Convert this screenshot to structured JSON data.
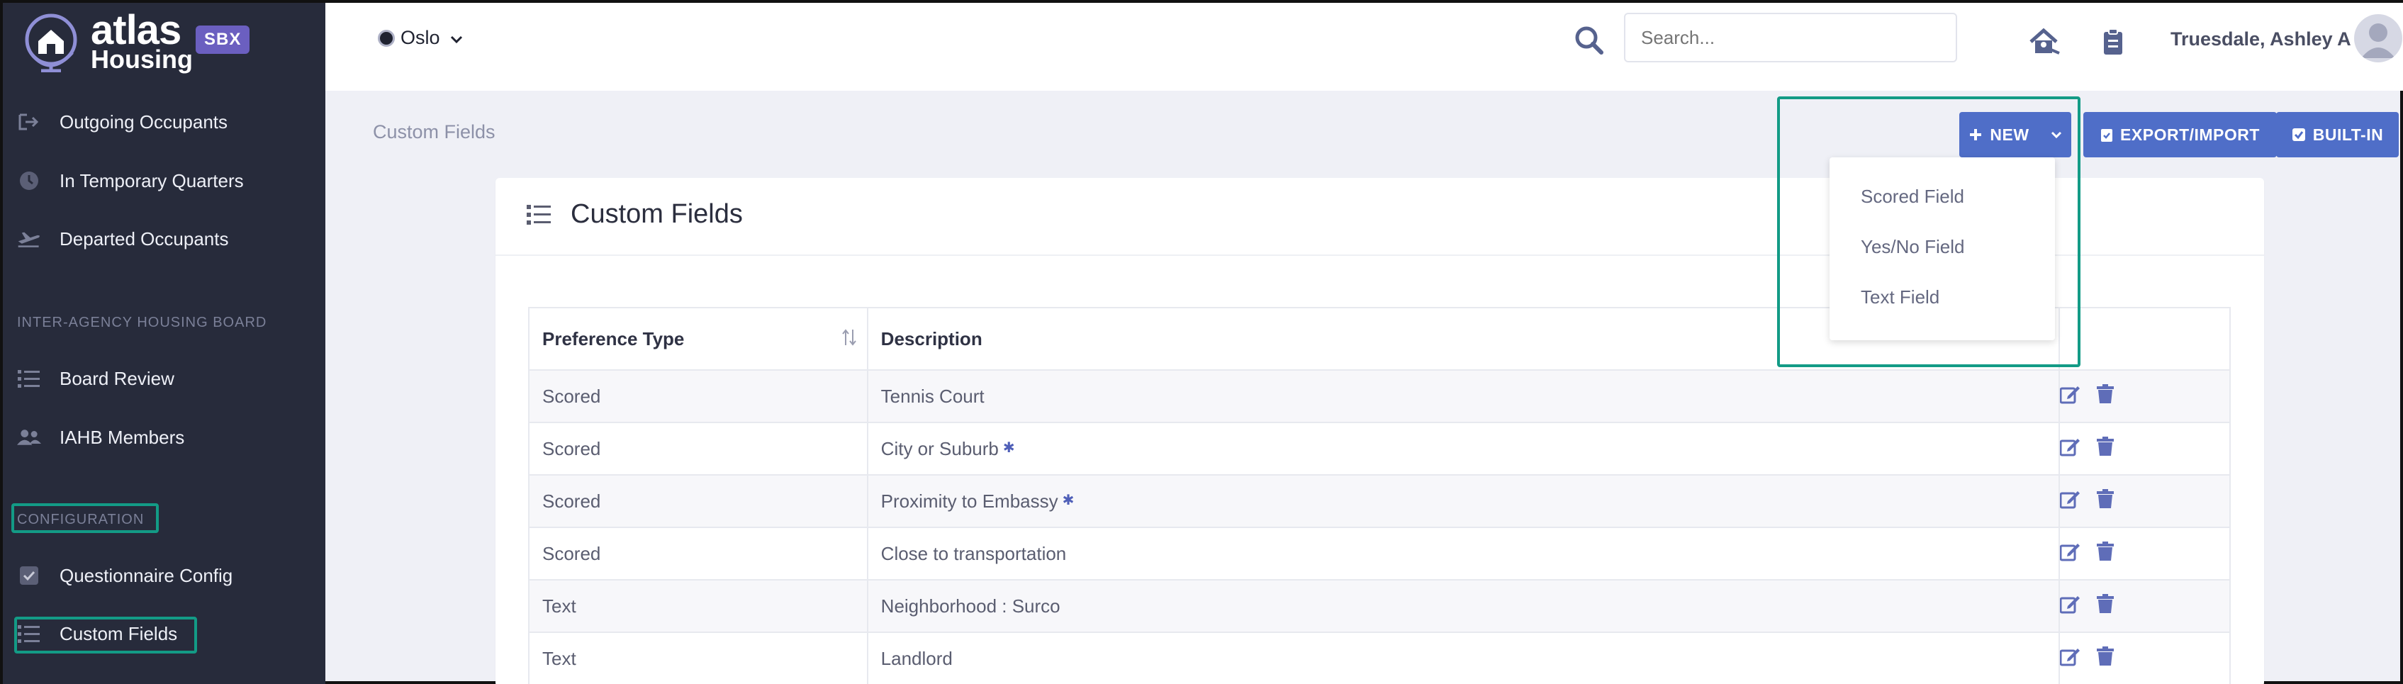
{
  "brand": {
    "name": "atlas",
    "sub": "Housing",
    "env_badge": "SBX"
  },
  "sidebar": {
    "items_top": [
      {
        "label": "Outgoing Occupants",
        "icon": "sign-out-icon"
      },
      {
        "label": "In Temporary Quarters",
        "icon": "clock-icon"
      },
      {
        "label": "Departed Occupants",
        "icon": "plane-departure-icon"
      }
    ],
    "section_board": "INTER-AGENCY HOUSING BOARD",
    "items_board": [
      {
        "label": "Board Review",
        "icon": "list-icon"
      },
      {
        "label": "IAHB Members",
        "icon": "users-icon"
      }
    ],
    "section_config": "CONFIGURATION",
    "items_config": [
      {
        "label": "Questionnaire Config",
        "icon": "check-square-icon"
      },
      {
        "label": "Custom Fields",
        "icon": "list-icon"
      }
    ]
  },
  "topbar": {
    "city": "Oslo",
    "search_placeholder": "Search...",
    "user_name": "Truesdale, Ashley A"
  },
  "page": {
    "breadcrumb": "Custom Fields",
    "buttons": {
      "new": "NEW",
      "export": "EXPORT/IMPORT",
      "builtin": "BUILT-IN"
    },
    "new_menu": [
      "Scored Field",
      "Yes/No Field",
      "Text Field"
    ],
    "card_title": "Custom Fields",
    "table": {
      "headers": [
        "Preference Type",
        "Description",
        ""
      ],
      "rows": [
        {
          "type": "Scored",
          "description": "Tennis Court",
          "starred": false
        },
        {
          "type": "Scored",
          "description": "City or Suburb",
          "starred": true
        },
        {
          "type": "Scored",
          "description": "Proximity to Embassy",
          "starred": true
        },
        {
          "type": "Scored",
          "description": "Close to transportation",
          "starred": false
        },
        {
          "type": "Text",
          "description": "Neighborhood : Surco",
          "starred": false
        },
        {
          "type": "Text",
          "description": "Landlord",
          "starred": false
        }
      ]
    }
  },
  "colors": {
    "primary": "#4f6ec8",
    "sidebar": "#272b3b",
    "highlight": "#139b86",
    "badge": "#6b5fc0"
  }
}
